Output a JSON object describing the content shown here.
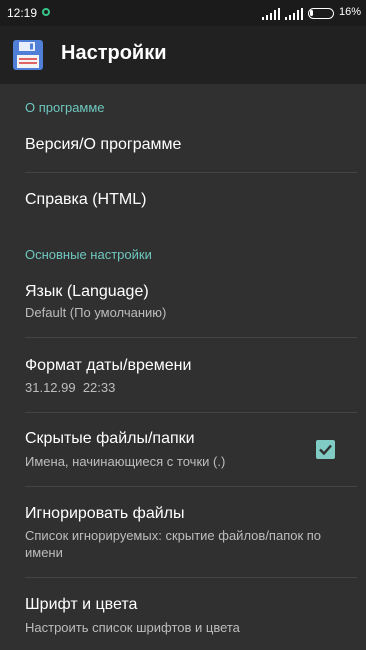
{
  "status": {
    "time": "12:19",
    "battery_pct": "16%",
    "icons": [
      "notification-dot-icon",
      "signal-icon",
      "signal-icon",
      "battery-icon"
    ]
  },
  "appbar": {
    "title": "Настройки",
    "icon": "floppy-disk-icon"
  },
  "sections": [
    {
      "title": "О программе"
    },
    {
      "title": "Основные настройки"
    }
  ],
  "items": [
    {
      "label": "Версия/О программе"
    },
    {
      "label": "Справка (HTML)"
    },
    {
      "label": "Язык (Language)",
      "sub": "Default (По умолчанию)"
    },
    {
      "label": "Формат даты/времени",
      "sub": "31.12.99  22:33"
    },
    {
      "label": "Скрытые файлы/папки",
      "sub": "Имена, начинающиеся с точки (.)",
      "checked": true
    },
    {
      "label": "Игнорировать файлы",
      "sub": "Список игнорируемых: скрытие файлов/папок по имени"
    },
    {
      "label": "Шрифт и цвета",
      "sub": "Настроить список шрифтов и цвета"
    }
  ],
  "colors": {
    "accent": "#80cbc4",
    "section_text": "#6fc7bf",
    "background": "#303030",
    "appbar": "#212121"
  }
}
